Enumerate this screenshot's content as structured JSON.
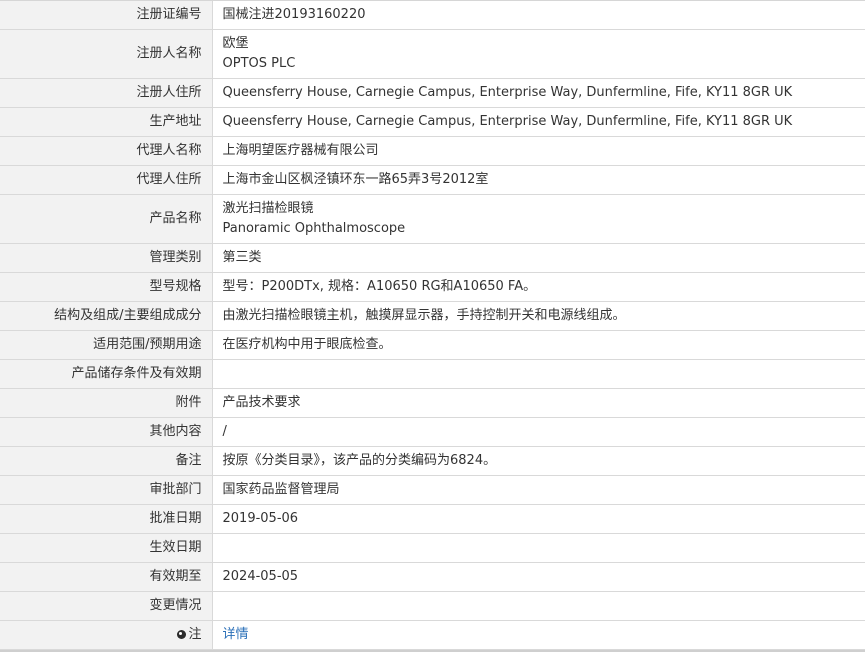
{
  "rows": [
    {
      "label": "注册证编号",
      "lines": [
        "国械注进20193160220"
      ]
    },
    {
      "label": "注册人名称",
      "lines": [
        "欧堡",
        "OPTOS PLC"
      ]
    },
    {
      "label": "注册人住所",
      "lines": [
        "Queensferry House, Carnegie Campus, Enterprise Way, Dunfermline, Fife, KY11 8GR UK"
      ]
    },
    {
      "label": "生产地址",
      "lines": [
        "Queensferry House, Carnegie Campus, Enterprise Way, Dunfermline, Fife, KY11 8GR UK"
      ]
    },
    {
      "label": "代理人名称",
      "lines": [
        "上海明望医疗器械有限公司"
      ]
    },
    {
      "label": "代理人住所",
      "lines": [
        "上海市金山区枫泾镇环东一路65弄3号2012室"
      ]
    },
    {
      "label": "产品名称",
      "lines": [
        "激光扫描检眼镜",
        "Panoramic Ophthalmoscope"
      ]
    },
    {
      "label": "管理类别",
      "lines": [
        "第三类"
      ]
    },
    {
      "label": "型号规格",
      "lines": [
        "型号：P200DTx, 规格：A10650 RG和A10650 FA。"
      ]
    },
    {
      "label": "结构及组成/主要组成成分",
      "lines": [
        "由激光扫描检眼镜主机，触摸屏显示器，手持控制开关和电源线组成。"
      ]
    },
    {
      "label": "适用范围/预期用途",
      "lines": [
        "在医疗机构中用于眼底检查。"
      ]
    },
    {
      "label": "产品储存条件及有效期",
      "lines": [
        ""
      ]
    },
    {
      "label": "附件",
      "lines": [
        "产品技术要求"
      ]
    },
    {
      "label": "其他内容",
      "lines": [
        "/"
      ]
    },
    {
      "label": "备注",
      "lines": [
        "按原《分类目录》，该产品的分类编码为6824。"
      ]
    },
    {
      "label": "审批部门",
      "lines": [
        "国家药品监督管理局"
      ]
    },
    {
      "label": "批准日期",
      "lines": [
        "2019-05-06"
      ]
    },
    {
      "label": "生效日期",
      "lines": [
        ""
      ]
    },
    {
      "label": "有效期至",
      "lines": [
        "2024-05-05"
      ]
    },
    {
      "label": "变更情况",
      "lines": [
        ""
      ]
    }
  ],
  "note_row": {
    "label": "注",
    "icon": "note-icon",
    "link_text": "详情"
  }
}
